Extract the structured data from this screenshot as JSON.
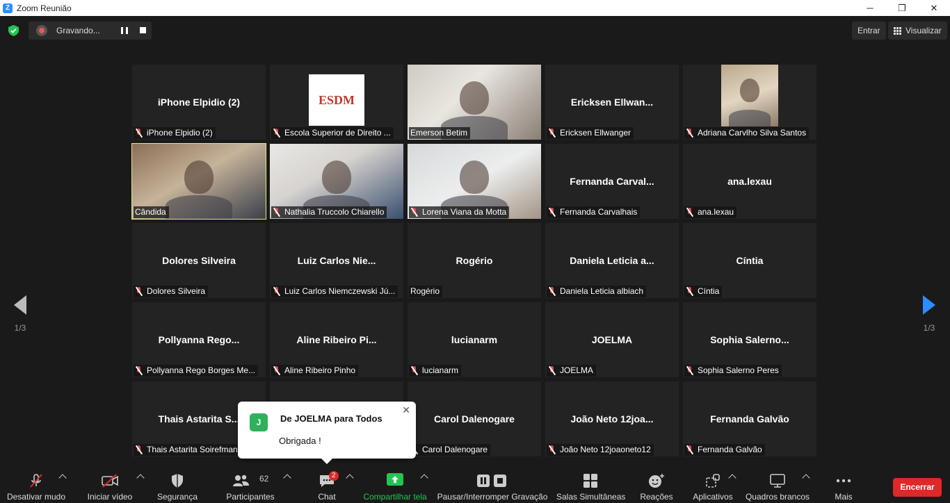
{
  "window": {
    "title": "Zoom Reunião",
    "app_icon": "Z",
    "controls": [
      "─",
      "❐",
      "✕"
    ]
  },
  "topbar": {
    "recording_label": "Gravando...",
    "enter_label": "Entrar",
    "view_label": "Visualizar"
  },
  "pager": {
    "left": "1/3",
    "right": "1/3"
  },
  "tiles": [
    {
      "big": "iPhone Elpidio (2)",
      "label": "iPhone Elpidio (2)",
      "muted": true
    },
    {
      "big": "",
      "label": "Escola Superior de Direito ...",
      "muted": true,
      "logo": "ESDM"
    },
    {
      "big": "",
      "label": "Emerson Betim",
      "muted": false,
      "video": true
    },
    {
      "big": "Ericksen  Ellwan...",
      "label": "Ericksen Ellwanger",
      "muted": true
    },
    {
      "big": "",
      "label": "Adriana Carvlho Silva Santos",
      "muted": true,
      "video": true
    },
    {
      "big": "",
      "label": "Cândida",
      "muted": false,
      "video": true,
      "active": true
    },
    {
      "big": "",
      "label": "Nathalia Truccolo Chiarello",
      "muted": true,
      "video": true
    },
    {
      "big": "",
      "label": "Lorena Viana da Motta",
      "muted": true,
      "video": true
    },
    {
      "big": "Fernanda  Carval...",
      "label": "Fernanda Carvalhais",
      "muted": true
    },
    {
      "big": "ana.lexau",
      "label": "ana.lexau",
      "muted": true
    },
    {
      "big": "Dolores Silveira",
      "label": "Dolores Silveira",
      "muted": true
    },
    {
      "big": "Luiz Carlos  Nie...",
      "label": "Luiz Carlos Niemczewski Jú...",
      "muted": true
    },
    {
      "big": "Rogério",
      "label": "Rogério",
      "muted": false
    },
    {
      "big": "Daniela Leticia a...",
      "label": "Daniela Leticia albiach",
      "muted": true
    },
    {
      "big": "Cíntia",
      "label": "Cíntia",
      "muted": true
    },
    {
      "big": "Pollyanna  Rego...",
      "label": "Pollyanna Rego Borges Me...",
      "muted": true
    },
    {
      "big": "Aline Ribeiro  Pi...",
      "label": "Aline Ribeiro Pinho",
      "muted": true
    },
    {
      "big": "lucianarm",
      "label": "lucianarm",
      "muted": true
    },
    {
      "big": "JOELMA",
      "label": "JOELMA",
      "muted": true
    },
    {
      "big": "Sophia  Salerno...",
      "label": "Sophia Salerno Peres",
      "muted": true
    },
    {
      "big": "Thais Astarita S...",
      "label": "Thais Astarita Soirefmann",
      "muted": true
    },
    {
      "big": "",
      "label": "",
      "muted": false
    },
    {
      "big": "Carol Dalenogare",
      "label": "Carol Dalenogare",
      "muted": true
    },
    {
      "big": "João Neto 12joa...",
      "label": "João Neto 12joaoneto12",
      "muted": true
    },
    {
      "big": "Fernanda Galvão",
      "label": "Fernanda Galvão",
      "muted": true
    }
  ],
  "chat_toast": {
    "avatar": "J",
    "from": "De JOELMA para Todos",
    "message": "Obrigada !",
    "close": "✕"
  },
  "toolbar": {
    "mute": "Desativar mudo",
    "video": "Iniciar vídeo",
    "security": "Segurança",
    "participants": "Participantes",
    "participants_count": "62",
    "chat": "Chat",
    "chat_badge": "2",
    "share": "Compartilhar tela",
    "recording": "Pausar/Interromper Gravação",
    "breakout": "Salas Simultâneas",
    "reactions": "Reações",
    "apps": "Aplicativos",
    "whiteboards": "Quadros brancos",
    "more": "Mais",
    "end": "Encerrar"
  },
  "colors": {
    "accent": "#2d8cff",
    "end": "#e02828",
    "share": "#23c552",
    "active_speaker": "#e5ec87"
  }
}
